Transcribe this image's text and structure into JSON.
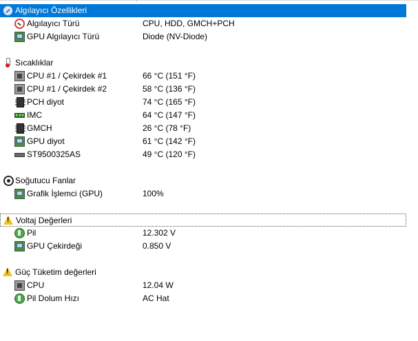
{
  "groups": {
    "sensor": "Algılayıcı Özellikleri",
    "temps": "Sıcaklıklar",
    "fans": "Soğutucu Fanlar",
    "voltage": "Voltaj Değerleri",
    "power": "Güç Tüketim değerleri"
  },
  "sensor_rows": [
    {
      "label": "Algılayıcı Türü",
      "value": "CPU, HDD, GMCH+PCH"
    },
    {
      "label": "GPU Algılayıcı Türü",
      "value": "Diode  (NV-Diode)"
    }
  ],
  "temp_rows": [
    {
      "label": "CPU #1 / Çekirdek #1",
      "value": "66 °C  (151 °F)"
    },
    {
      "label": "CPU #1 / Çekirdek #2",
      "value": "58 °C  (136 °F)"
    },
    {
      "label": "PCH diyot",
      "value": "74 °C  (165 °F)"
    },
    {
      "label": "IMC",
      "value": "64 °C  (147 °F)"
    },
    {
      "label": "GMCH",
      "value": "26 °C  (78 °F)"
    },
    {
      "label": "GPU diyot",
      "value": "61 °C  (142 °F)"
    },
    {
      "label": "ST9500325AS",
      "value": "49 °C  (120 °F)"
    }
  ],
  "fan_rows": [
    {
      "label": "Grafik İşlemci (GPU)",
      "value": "100%"
    }
  ],
  "voltage_rows": [
    {
      "label": "Pil",
      "value": "12.302 V"
    },
    {
      "label": "GPU Çekirdeği",
      "value": "0.850 V"
    }
  ],
  "power_rows": [
    {
      "label": "CPU",
      "value": "12.04 W"
    },
    {
      "label": "Pil Dolum Hızı",
      "value": "AC Hat"
    }
  ],
  "colors": {
    "selection": "#0078d7"
  }
}
